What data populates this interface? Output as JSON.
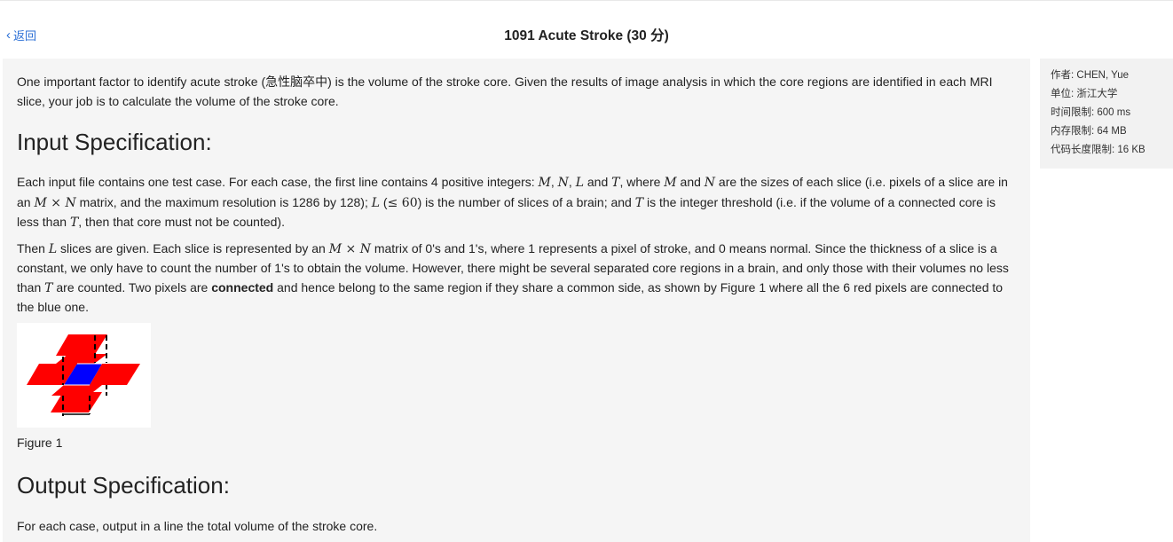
{
  "header": {
    "back_label": "返回",
    "title": "1091 Acute Stroke (30 分)"
  },
  "problem": {
    "intro": "One important factor to identify acute stroke (急性脑卒中) is the volume of the stroke core. Given the results of image analysis in which the core regions are identified in each MRI slice, your job is to calculate the volume of the stroke core.",
    "input_heading": "Input Specification:",
    "input_p1": {
      "a": "Each input file contains one test case. For each case, the first line contains 4 positive integers: ",
      "M": "M",
      "comma1": ", ",
      "N": "N",
      "comma2": ", ",
      "L": "L",
      "and": " and ",
      "T": "T",
      "b": ", where ",
      "M2": "M",
      "c": " and ",
      "N2": "N",
      "d": " are the sizes of each slice (i.e. pixels of a slice are in an ",
      "M3": "M",
      "times": " × ",
      "N3": "N",
      "e": " matrix, and the maximum resolution is 1286 by 128); ",
      "L2": "L",
      "f": " (",
      "le": "≤ 60",
      "g": ") is the number of slices of a brain; and ",
      "T2": "T",
      "h": " is the integer threshold (i.e. if the volume of a connected core is less than ",
      "T3": "T",
      "i": ", then that core must not be counted)."
    },
    "input_p2": {
      "a": "Then ",
      "L": "L",
      "b": " slices are given. Each slice is represented by an ",
      "M": "M",
      "times": " × ",
      "N": "N",
      "c": " matrix of 0's and 1's, where 1 represents a pixel of stroke, and 0 means normal. Since the thickness of a slice is a constant, we only have to count the number of 1's to obtain the volume. However, there might be several separated core regions in a brain, and only those with their volumes no less than ",
      "T": "T",
      "d": " are counted. Two pixels are ",
      "bold": "connected",
      "e": " and hence belong to the same region if they share a common side, as shown by Figure 1 where all the 6 red pixels are connected to the blue one."
    },
    "figure_caption": "Figure 1",
    "output_heading": "Output Specification:",
    "output_text": "For each case, output in a line the total volume of the stroke core."
  },
  "sidebar": {
    "author": "作者: CHEN, Yue",
    "unit": "单位: 浙江大学",
    "time_limit": "时间限制: 600 ms",
    "memory_limit": "内存限制: 64 MB",
    "code_limit": "代码长度限制: 16 KB"
  },
  "colors": {
    "link": "#2b6fd6",
    "panel_bg": "#f5f5f5",
    "pixel_red": "#ff0000",
    "pixel_blue": "#0000ff"
  }
}
